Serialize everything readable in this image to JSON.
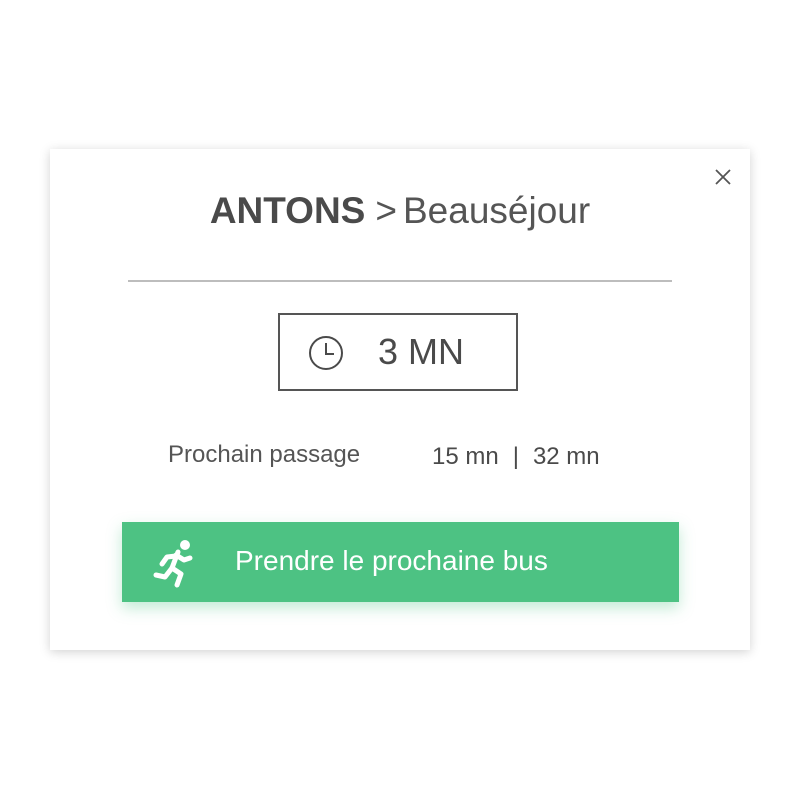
{
  "route": {
    "origin": "ANTONS",
    "separator": ">",
    "destination": "Beauséjour"
  },
  "countdown": {
    "value": "3 MN",
    "icon": "clock-icon"
  },
  "next_passages": {
    "label": "Prochain passage",
    "times": [
      "15 mn",
      "32 mn"
    ],
    "separator": "|"
  },
  "cta": {
    "label": "Prendre le prochaine bus",
    "icon": "running-person-icon"
  },
  "colors": {
    "accent": "#4dc283",
    "text": "#4a4a4a",
    "divider": "#bdbdbd"
  }
}
